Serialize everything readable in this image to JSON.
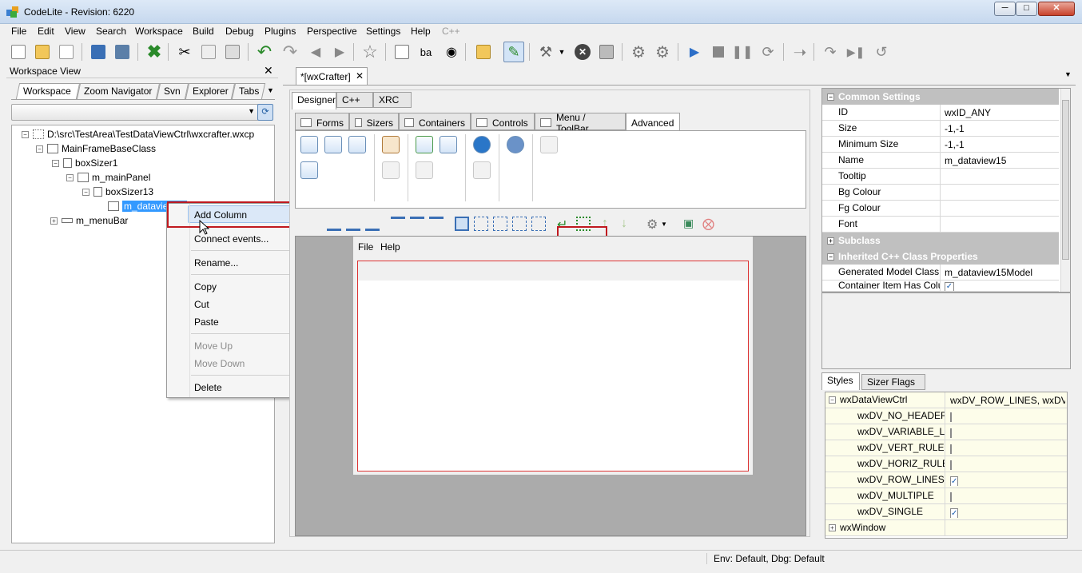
{
  "window": {
    "title": "CodeLite - Revision: 6220"
  },
  "menubar": [
    "File",
    "Edit",
    "View",
    "Search",
    "Workspace",
    "Build",
    "Debug",
    "Plugins",
    "Perspective",
    "Settings",
    "Help",
    "C++"
  ],
  "workspace_view": {
    "title": "Workspace View",
    "tabs": [
      "Workspace",
      "Zoom Navigator",
      "Svn",
      "Explorer",
      "Tabs"
    ],
    "tree": [
      {
        "label": "D:\\src\\TestArea\\TestDataViewCtrl\\wxcrafter.wxcp"
      },
      {
        "label": "MainFrameBaseClass"
      },
      {
        "label": "boxSizer1"
      },
      {
        "label": "m_mainPanel"
      },
      {
        "label": "boxSizer13"
      },
      {
        "label": "m_dataview15"
      },
      {
        "label": "m_menuBar"
      }
    ]
  },
  "context_menu": {
    "items": [
      "Add Column",
      "Connect events...",
      "Rename...",
      "Copy",
      "Cut",
      "Paste",
      "Move Up",
      "Move Down",
      "Delete"
    ]
  },
  "editor": {
    "doc_tab": "*[wxCrafter]",
    "main_tabs": [
      "Designer",
      "C++",
      "XRC"
    ],
    "sub_tabs": [
      "Forms",
      "Sizers",
      "Containers",
      "Controls",
      "Menu / ToolBar",
      "Advanced"
    ],
    "preview_menu": [
      "File",
      "Help"
    ]
  },
  "properties": {
    "categories": [
      "Common Settings",
      "Subclass",
      "Inherited C++ Class Properties"
    ],
    "rows": [
      {
        "key": "ID",
        "value": "wxID_ANY"
      },
      {
        "key": "Size",
        "value": "-1,-1"
      },
      {
        "key": "Minimum Size",
        "value": "-1,-1"
      },
      {
        "key": "Name",
        "value": "m_dataview15"
      },
      {
        "key": "Tooltip",
        "value": ""
      },
      {
        "key": "Bg Colour",
        "value": ""
      },
      {
        "key": "Fg Colour",
        "value": ""
      },
      {
        "key": "Font",
        "value": ""
      }
    ],
    "inherited": [
      {
        "key": "Generated Model Class Name",
        "value": "m_dataview15Model"
      },
      {
        "key": "Container Item Has Columns",
        "value": ""
      }
    ]
  },
  "styles": {
    "tabs": [
      "Styles",
      "Sizer Flags"
    ],
    "group": {
      "key": "wxDataViewCtrl",
      "value": "wxDV_ROW_LINES, wxDV_SINGLE"
    },
    "rows": [
      {
        "key": "wxDV_NO_HEADER",
        "checked": false
      },
      {
        "key": "wxDV_VARIABLE_LINE_HEIGHT",
        "checked": false
      },
      {
        "key": "wxDV_VERT_RULES",
        "checked": false
      },
      {
        "key": "wxDV_HORIZ_RULES",
        "checked": false
      },
      {
        "key": "wxDV_ROW_LINES",
        "checked": true
      },
      {
        "key": "wxDV_MULTIPLE",
        "checked": false
      },
      {
        "key": "wxDV_SINGLE",
        "checked": true
      }
    ],
    "footer": "wxWindow"
  },
  "statusbar": {
    "env": "Env: Default, Dbg: Default"
  },
  "colors": {
    "accent": "#3399ff",
    "highlight": "#c0191f"
  }
}
